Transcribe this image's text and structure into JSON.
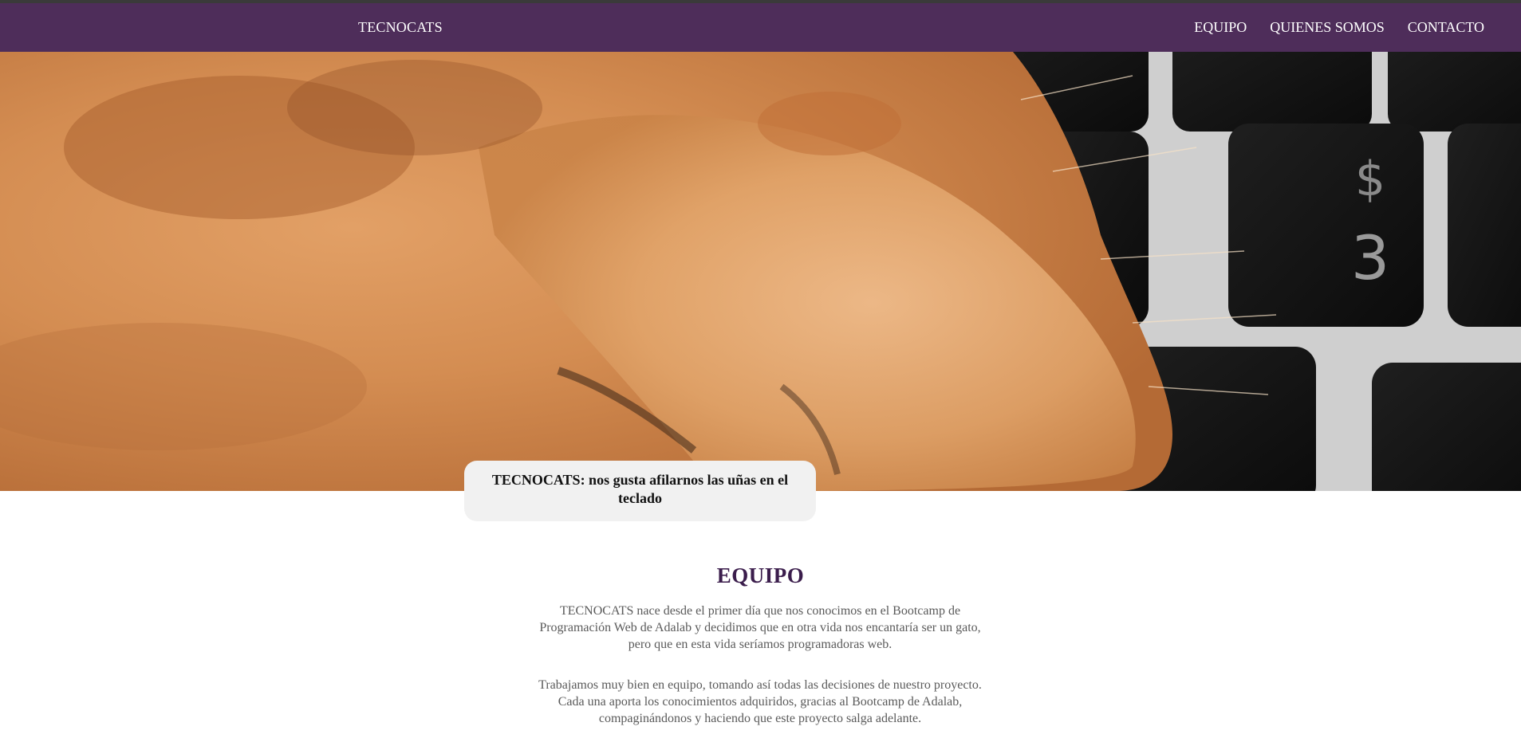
{
  "nav": {
    "brand": "TECNOCATS",
    "links": [
      "EQUIPO",
      "QUIENES SOMOS",
      "CONTACTO"
    ]
  },
  "hero": {
    "image": "orange-cat-paw-on-keyboard",
    "keys": [
      "$",
      "3"
    ],
    "caption": "TECNOCATS: nos gusta afilarnos las uñas en el teclado"
  },
  "team": {
    "title": "EQUIPO",
    "paragraphs": [
      "TECNOCATS nace desde el primer día que nos conocimos en el Bootcamp de Programación Web de Adalab y decidimos que en otra vida nos encantaría ser un gato, pero que en esta vida seríamos programadoras web.",
      "Trabajamos muy bien en equipo, tomando así todas las decisiones de nuestro proyecto. Cada una aporta los conocimientos adquiridos, gracias al Bootcamp de Adalab, compaginándonos y haciendo que este proyecto salga adelante."
    ]
  },
  "colors": {
    "navbar": "#4e2d5a",
    "title": "#3b1d4c",
    "body_text": "#5a5a5a",
    "caption_bg": "#f1f1f1",
    "fur": "#d9955a",
    "keycap": "#141414"
  }
}
